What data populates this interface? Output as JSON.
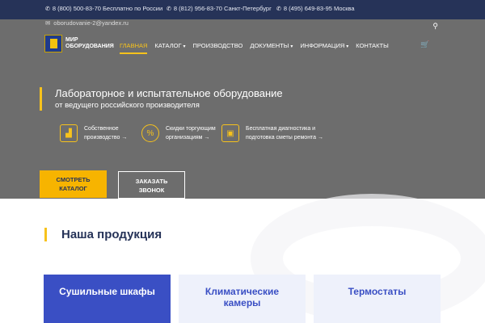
{
  "topbar": {
    "phones": [
      {
        "icon": "phone-icon",
        "text": "8 (800) 500-83-70 Бесплатно по России"
      },
      {
        "icon": "phone-icon",
        "text": "8 (812) 956-83-70 Санкт-Петербург"
      },
      {
        "icon": "phone-icon",
        "text": "8 (495) 649-83-95 Москва"
      }
    ],
    "email": "oborudovanie-2@yandex.ru"
  },
  "logo": {
    "line1": "Мир",
    "line2": "оборудования"
  },
  "nav": {
    "items": [
      {
        "label": "Главная",
        "active": true,
        "dropdown": false
      },
      {
        "label": "Каталог",
        "active": false,
        "dropdown": true
      },
      {
        "label": "Производство",
        "active": false,
        "dropdown": false
      },
      {
        "label": "Документы",
        "active": false,
        "dropdown": true
      },
      {
        "label": "Информация",
        "active": false,
        "dropdown": true
      },
      {
        "label": "Контакты",
        "active": false,
        "dropdown": false
      }
    ]
  },
  "hero": {
    "title": "Лабораторное и испытательное оборудование",
    "subtitle": "от ведущего российского производителя",
    "features": [
      {
        "icon": "factory-icon",
        "line1": "Собственное",
        "line2": "производство →"
      },
      {
        "icon": "percent-icon",
        "line1": "Скидки торгующим",
        "line2": "организациям →"
      },
      {
        "icon": "diagnostics-icon",
        "line1": "Бесплатная диагностика и",
        "line2": "подготовка сметы ремонта →"
      }
    ],
    "primary_button": {
      "line1": "Смотреть",
      "line2": "каталог"
    },
    "secondary_button": {
      "line1": "Заказать",
      "line2": "звонок"
    }
  },
  "products": {
    "title": "Наша продукция",
    "cards": [
      {
        "line1": "Сушильные шкафы",
        "line2": ""
      },
      {
        "line1": "Климатические",
        "line2": "камеры"
      },
      {
        "line1": "Термостаты",
        "line2": ""
      }
    ]
  },
  "colors": {
    "accent": "#f7c21c",
    "brand": "#263358",
    "card_blue": "#3a4fc4"
  }
}
